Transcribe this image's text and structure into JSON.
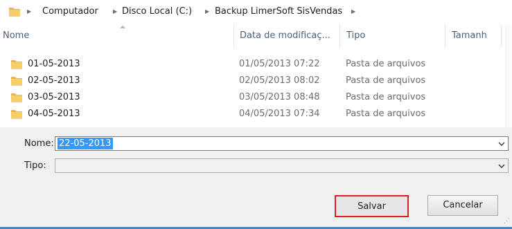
{
  "breadcrumb": {
    "items": [
      "Computador",
      "Disco Local (C:)",
      "Backup LimerSoft SisVendas"
    ],
    "separator_icon": "chevron-right-icon"
  },
  "file_list": {
    "columns": [
      "Nome",
      "Data de modificaç...",
      "Tipo",
      "Tamanh"
    ],
    "rows": [
      {
        "name": "01-05-2013",
        "date": "01/05/2013 07:22",
        "type": "Pasta de arquivos"
      },
      {
        "name": "02-05-2013",
        "date": "02/05/2013 08:02",
        "type": "Pasta de arquivos"
      },
      {
        "name": "03-05-2013",
        "date": "03/05/2013 08:48",
        "type": "Pasta de arquivos"
      },
      {
        "name": "04-05-2013",
        "date": "04/05/2013 07:34",
        "type": "Pasta de arquivos"
      }
    ]
  },
  "form": {
    "name_label": "Nome:",
    "name_value": "22-05-2013",
    "type_label": "Tipo:",
    "type_value": ""
  },
  "buttons": {
    "save": "Salvar",
    "cancel": "Cancelar"
  },
  "colors": {
    "folder": "#e8b84a",
    "selection": "#3399ff",
    "highlight_border": "#e01b24"
  }
}
